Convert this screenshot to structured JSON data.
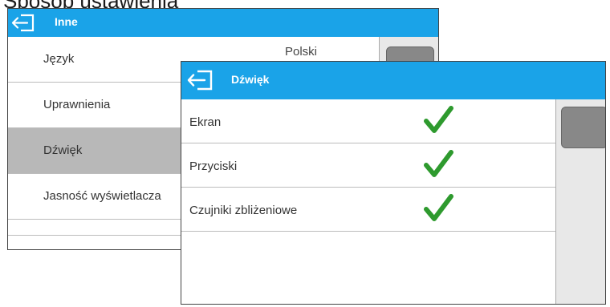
{
  "heading_partial": "Sposób ustawienia",
  "back_window": {
    "title": "Inne",
    "rows": [
      {
        "label": "Język",
        "value": "Polski"
      },
      {
        "label": "Uprawnienia"
      },
      {
        "label": "Dźwięk"
      },
      {
        "label": "Jasność wyświetlacza"
      }
    ],
    "selected_index": 2
  },
  "front_window": {
    "title": "Dźwięk",
    "rows": [
      {
        "label": "Ekran",
        "checked": true
      },
      {
        "label": "Przyciski",
        "checked": true
      },
      {
        "label": "Czujniki zbliżeniowe",
        "checked": true
      }
    ]
  },
  "icons": {
    "back": "back-arrow-icon",
    "check": "checkmark-icon"
  },
  "colors": {
    "titlebar": "#1aa3e8",
    "check": "#2e9a2e",
    "selected_row": "#b8b8b8"
  }
}
